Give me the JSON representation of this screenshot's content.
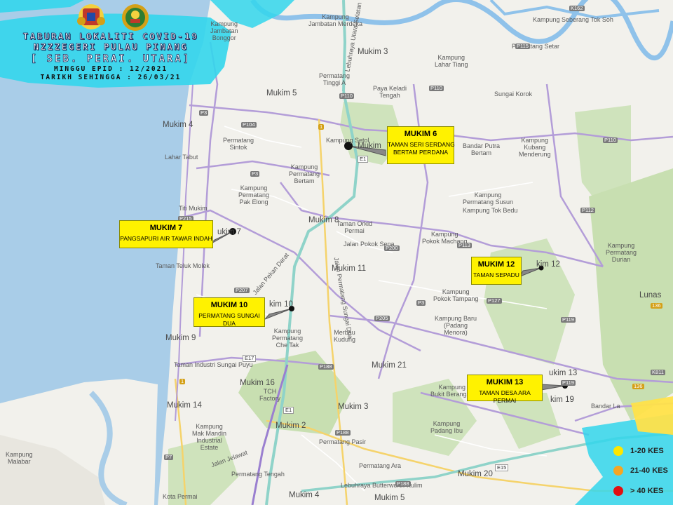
{
  "header": {
    "title_line1": "TABURAN LOKALITI COVID-19",
    "title_line2": "NZZZEGERI PULAU PINANG",
    "district": "[ SEB. PERAI. UTARA]",
    "epid_week": "MINGGU EPID : 12/2021",
    "date_until": "TARIKH SEHINGGA : 26/03/21",
    "logos": [
      "jata-negara-crest-logo",
      "jata-pulau-pinang-logo"
    ]
  },
  "callouts": [
    {
      "mukim": "MUKIM 6",
      "locality": "TAMAN SERI SERDANG\nBERTAM PERDANA"
    },
    {
      "mukim": "MUKIM 7",
      "locality": "PANGSAPURI AIR TAWAR INDAH"
    },
    {
      "mukim": "MUKIM 10",
      "locality": "PERMATANG SUNGAI DUA"
    },
    {
      "mukim": "MUKIM 12",
      "locality": "TAMAN SEPADU"
    },
    {
      "mukim": "MUKIM 13",
      "locality": "TAMAN DESA ARA PERMAI"
    }
  ],
  "legend": [
    {
      "label": "1-20 KES",
      "color": "#ffe600"
    },
    {
      "label": "21-40 KES",
      "color": "#f5a623"
    },
    {
      "label": "> 40 KES",
      "color": "#e01010"
    }
  ],
  "map_labels": {
    "mukim_3": "Mukim 3",
    "mukim_4": "Mukim 4",
    "mukim_5": "Mukim 5",
    "mukim_6": "Mukim",
    "mukim_7": "ukim 7",
    "mukim_8": "Mukim 8",
    "mukim_9": "Mukim 9",
    "mukim_10": "kim 10",
    "mukim_11": "Mukim 11",
    "mukim_12": "kim 12",
    "mukim_13": "ukim 13",
    "mukim_14": "Mukim 14",
    "mukim_16": "Mukim 16",
    "mukim_19": "kim 19",
    "mukim_20": "Mukim 20",
    "mukim_21": "Mukim 21",
    "mukim_2": "Mukim 2",
    "mukim_3b": "Mukim 3",
    "mukim_4b": "Mukim 4",
    "mukim_5b": "Mukim 5",
    "lunas": "Lunas",
    "kg_jambatan": "Kampung\nJambatan Merdeka",
    "kg_sekolah": "Kampung\nJambatan\nBonggor",
    "kg_seberang_tok_soh": "Kampung Seberang Tok Soh",
    "permatang_setar": "Permatang Setar",
    "kg_lahar_tiang": "Kampung\nLahar Tiang",
    "permatang_tinggi": "Permatang\nTinggi A",
    "paya_keladi": "Paya Keladi\nTengah",
    "sungai_korok": "Sungai Korok",
    "lebuhraya_utara": "Lebuhraya Utara Selatan",
    "kg_setol": "Kampung Setol",
    "bandar_putra": "Bandar Putra\nBertam",
    "kg_kubang": "Kampung\nKubang\nMenderung",
    "lahar_tabut": "Lahar Tabut",
    "permatang_sintok": "Permatang\nSintok",
    "kg_permatang_bertam": "Kampung\nPermatang\nBertam",
    "kg_permatang_pak_elong": "Kampung\nPermatang\nPak Elong",
    "titi_mukim": "Titi Mukim",
    "kg_susun": "Kampung\nPermatang Susun",
    "kg_tok_bedu": "Kampung Tok Bedu",
    "taman_orkid": "Taman Orkid\nPermai",
    "jalan_pokok_sena": "Jalan Pokok Sena",
    "kg_pokok_machang": "Kampung\nPokok Machang",
    "taman_teluk_molek": "Taman Teluk Molek",
    "jalan_pekan_darat": "Jalan Pekan Darat",
    "jalan_permatang_sungai_dua": "Jalan Permatang Sungai Dua",
    "kg_pokok_tampang": "Kampung\nPokok Tampang",
    "kg_permatang_durian": "Kampung\nPermatang\nDurian",
    "kg_permatang_che_tak": "Kampung\nPermatang\nChe Tak",
    "merbau_kudung": "Merbau\nKudung",
    "kg_baru": "Kampung Baru\n(Padang\nMenora)",
    "taman_industri": "Taman Industri Sungai Puyu",
    "tch_factory": "TCH\nFactory",
    "kg_bukit_berangan": "Kampung\nBukit Berangan",
    "kg_padang_ibu": "Kampung\nPadang Ibu",
    "bandar_la": "Bandar La",
    "kg_malabar": "Kampung\nMalabar",
    "kg_mak_mandin": "Kampung\nMak Mandin\nIndustrial\nEstate",
    "permatang_pasir": "Permatang Pasir",
    "permatang_ara": "Permatang Ara",
    "permatang_tengah": "Permatang Tengah",
    "kota_permai": "Kota Permai",
    "lebuhraya_butterworth": "Lebuhraya Butterworth-Kulim",
    "jalan_jelawat": "Jalan Jelawat",
    "mukim_bottom": "Mukim 5",
    "road_p110": "P110",
    "road_p3": "P3",
    "road_p104": "P104",
    "road_p215": "P215",
    "road_p207": "P207",
    "road_p200": "P200",
    "road_p113": "P113",
    "road_p127": "P127",
    "road_p119": "P119",
    "road_p112": "P112",
    "road_p205": "P205",
    "road_p188": "P188",
    "road_e1": "E1",
    "road_e17": "E17",
    "road_e15": "E15",
    "road_k162": "K162",
    "road_1": "1",
    "road_136": "136",
    "road_k811": "K811",
    "road_p7": "P7",
    "road_p115": "P115",
    "road_p16": "P16"
  }
}
